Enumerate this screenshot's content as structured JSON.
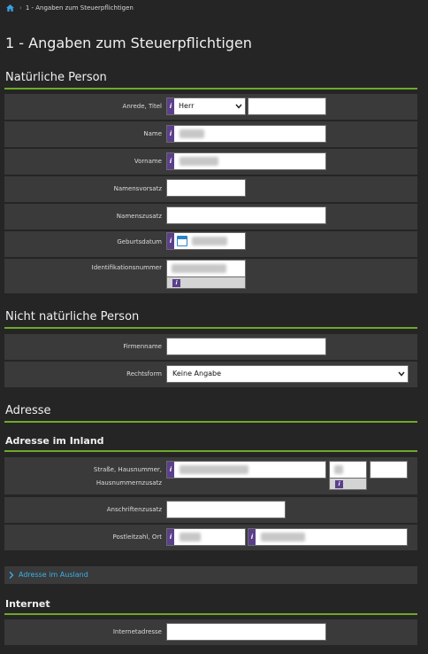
{
  "breadcrumb": {
    "home_icon": "home-icon",
    "current": "1 - Angaben zum Steuerpflichtigen"
  },
  "page_title": "1 - Angaben zum Steuerpflichtigen",
  "sections": {
    "natural": {
      "title": "Natürliche Person",
      "anrede_label": "Anrede,  Titel",
      "anrede_value": "Herr",
      "name_label": "Name",
      "vorname_label": "Vorname",
      "namensvorsatz_label": "Namensvorsatz",
      "namenszusatz_label": "Namenszusatz",
      "geburtsdatum_label": "Geburtsdatum",
      "idnr_label": "Identifikationsnummer"
    },
    "non_natural": {
      "title": "Nicht natürliche Person",
      "firmenname_label": "Firmenname",
      "rechtsform_label": "Rechtsform",
      "rechtsform_value": "Keine Angabe"
    },
    "address": {
      "title": "Adresse",
      "inland_title": "Adresse im Inland",
      "strasse_label_1": "Straße, Hausnummer,",
      "strasse_label_2": "Hausnummernzusatz",
      "anschriftenzusatz_label": "Anschriftenzusatz",
      "plz_label": "Postleitzahl,  Ort",
      "ausland_link": "Adresse im Ausland"
    },
    "internet": {
      "title": "Internet",
      "adresse_label": "Internetadresse"
    }
  },
  "info_glyph": "i",
  "colors": {
    "accent_green": "#6fa82a",
    "info_purple": "#5b3f8a",
    "link_blue": "#3ab0ea",
    "background": "#252525",
    "row_bg": "#3a3a3a"
  }
}
